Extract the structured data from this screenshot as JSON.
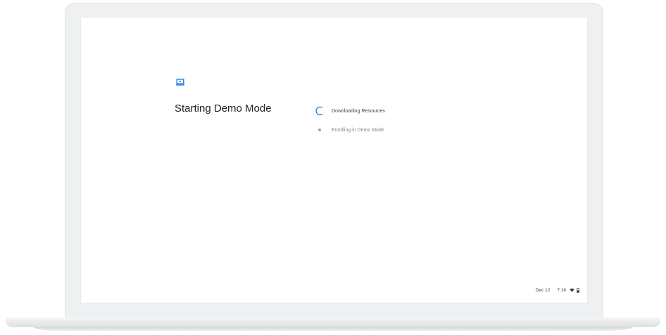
{
  "screen": {
    "title": "Starting Demo Mode",
    "icon": "laptop-icon",
    "steps": [
      {
        "label": "Downloading Resources",
        "status": "in-progress",
        "icon": "spinner-icon"
      },
      {
        "label": "Enrolling in Demo Mode",
        "status": "pending",
        "icon": "pending-dot-icon"
      }
    ]
  },
  "tray": {
    "date": "Dec 12",
    "time": "7:16",
    "icons": [
      "wifi-icon",
      "battery-icon"
    ]
  },
  "colors": {
    "accent": "#1a73e8",
    "text_primary": "#202124",
    "text_secondary": "#80868b"
  }
}
